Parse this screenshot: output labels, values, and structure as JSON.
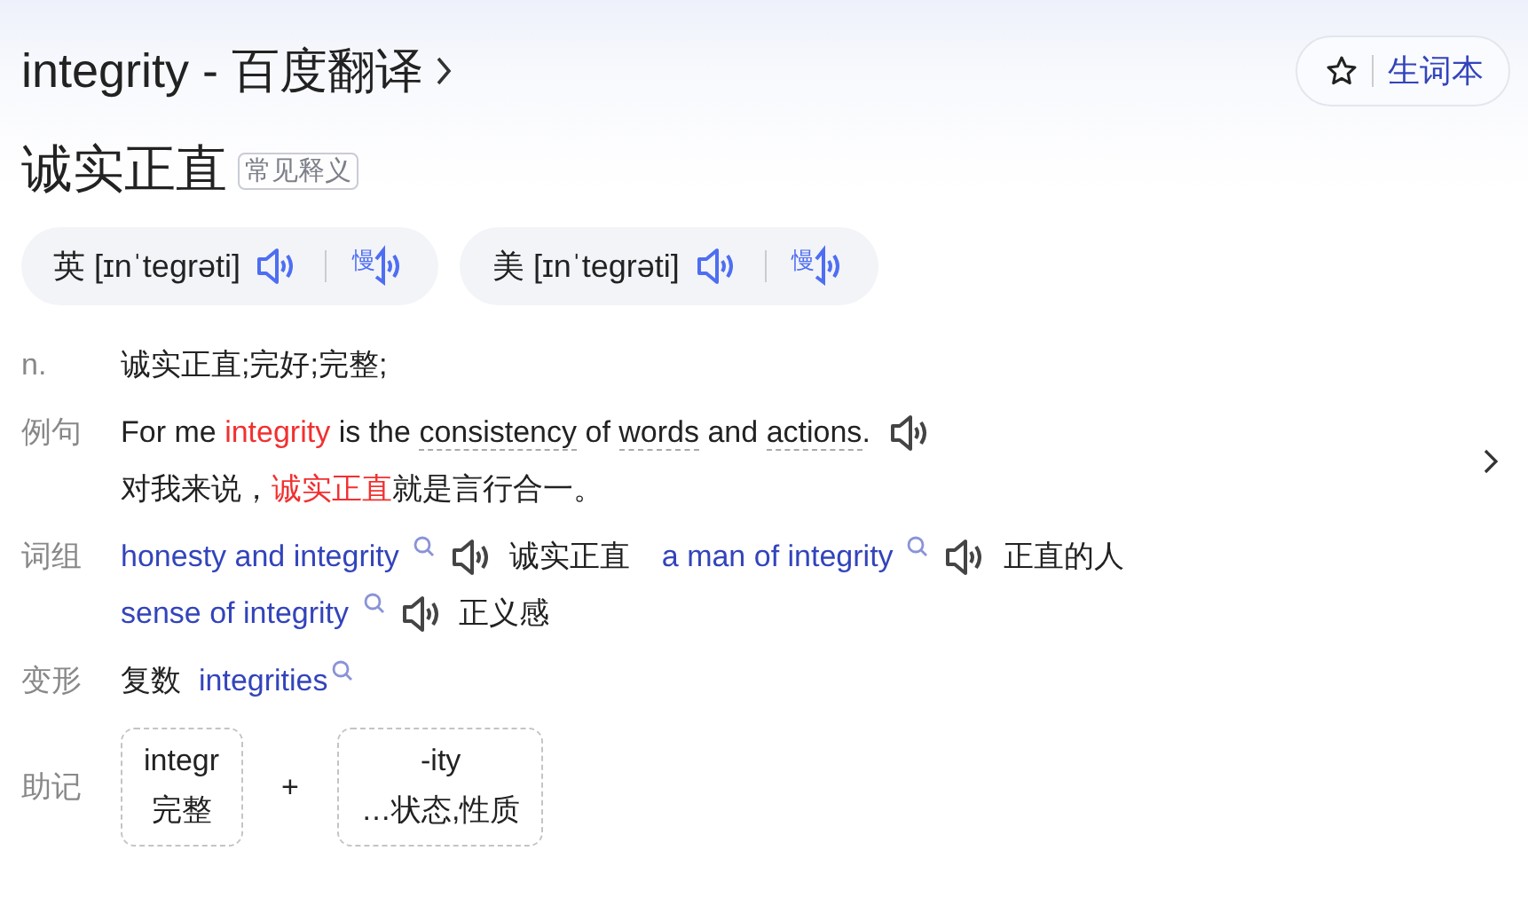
{
  "header": {
    "title": "integrity - 百度翻译",
    "wordbook_button": "生词本"
  },
  "headword": {
    "meaning": "诚实正直",
    "tag": "常见释义"
  },
  "pronunciations": [
    {
      "region": "英",
      "phonetic": "[ɪnˈtegrəti]",
      "slow_label": "慢"
    },
    {
      "region": "美",
      "phonetic": "[ɪnˈtegrəti]",
      "slow_label": "慢"
    }
  ],
  "definitions": [
    {
      "pos": "n.",
      "text": "诚实正直;完好;完整;"
    }
  ],
  "example": {
    "label": "例句",
    "sentence": [
      {
        "kind": "plain",
        "text": "For me "
      },
      {
        "kind": "highlight",
        "text": "integrity"
      },
      {
        "kind": "plain",
        "text": " is the "
      },
      {
        "kind": "underlined",
        "text": "consistency"
      },
      {
        "kind": "plain",
        "text": " of "
      },
      {
        "kind": "underlined",
        "text": "words"
      },
      {
        "kind": "plain",
        "text": " and "
      },
      {
        "kind": "underlined",
        "text": "actions"
      },
      {
        "kind": "plain",
        "text": "."
      }
    ],
    "translation": [
      {
        "kind": "plain",
        "text": "对我来说，"
      },
      {
        "kind": "highlight",
        "text": "诚实正直"
      },
      {
        "kind": "plain",
        "text": "就是言行合一。"
      }
    ]
  },
  "phrases": {
    "label": "词组",
    "rows": [
      [
        {
          "phrase": "honesty and integrity",
          "meaning": "诚实正直"
        },
        {
          "phrase": "a man of integrity",
          "meaning": "正直的人"
        }
      ],
      [
        {
          "phrase": "sense of integrity",
          "meaning": "正义感"
        }
      ]
    ]
  },
  "inflections": {
    "label": "变形",
    "items": [
      {
        "type": "复数",
        "word": "integrities"
      }
    ]
  },
  "mnemonic": {
    "label": "助记",
    "parts": [
      {
        "root": "integr",
        "meaning": "完整"
      },
      {
        "root": "-ity",
        "meaning": "…状态,性质"
      }
    ],
    "joiner": "+"
  }
}
